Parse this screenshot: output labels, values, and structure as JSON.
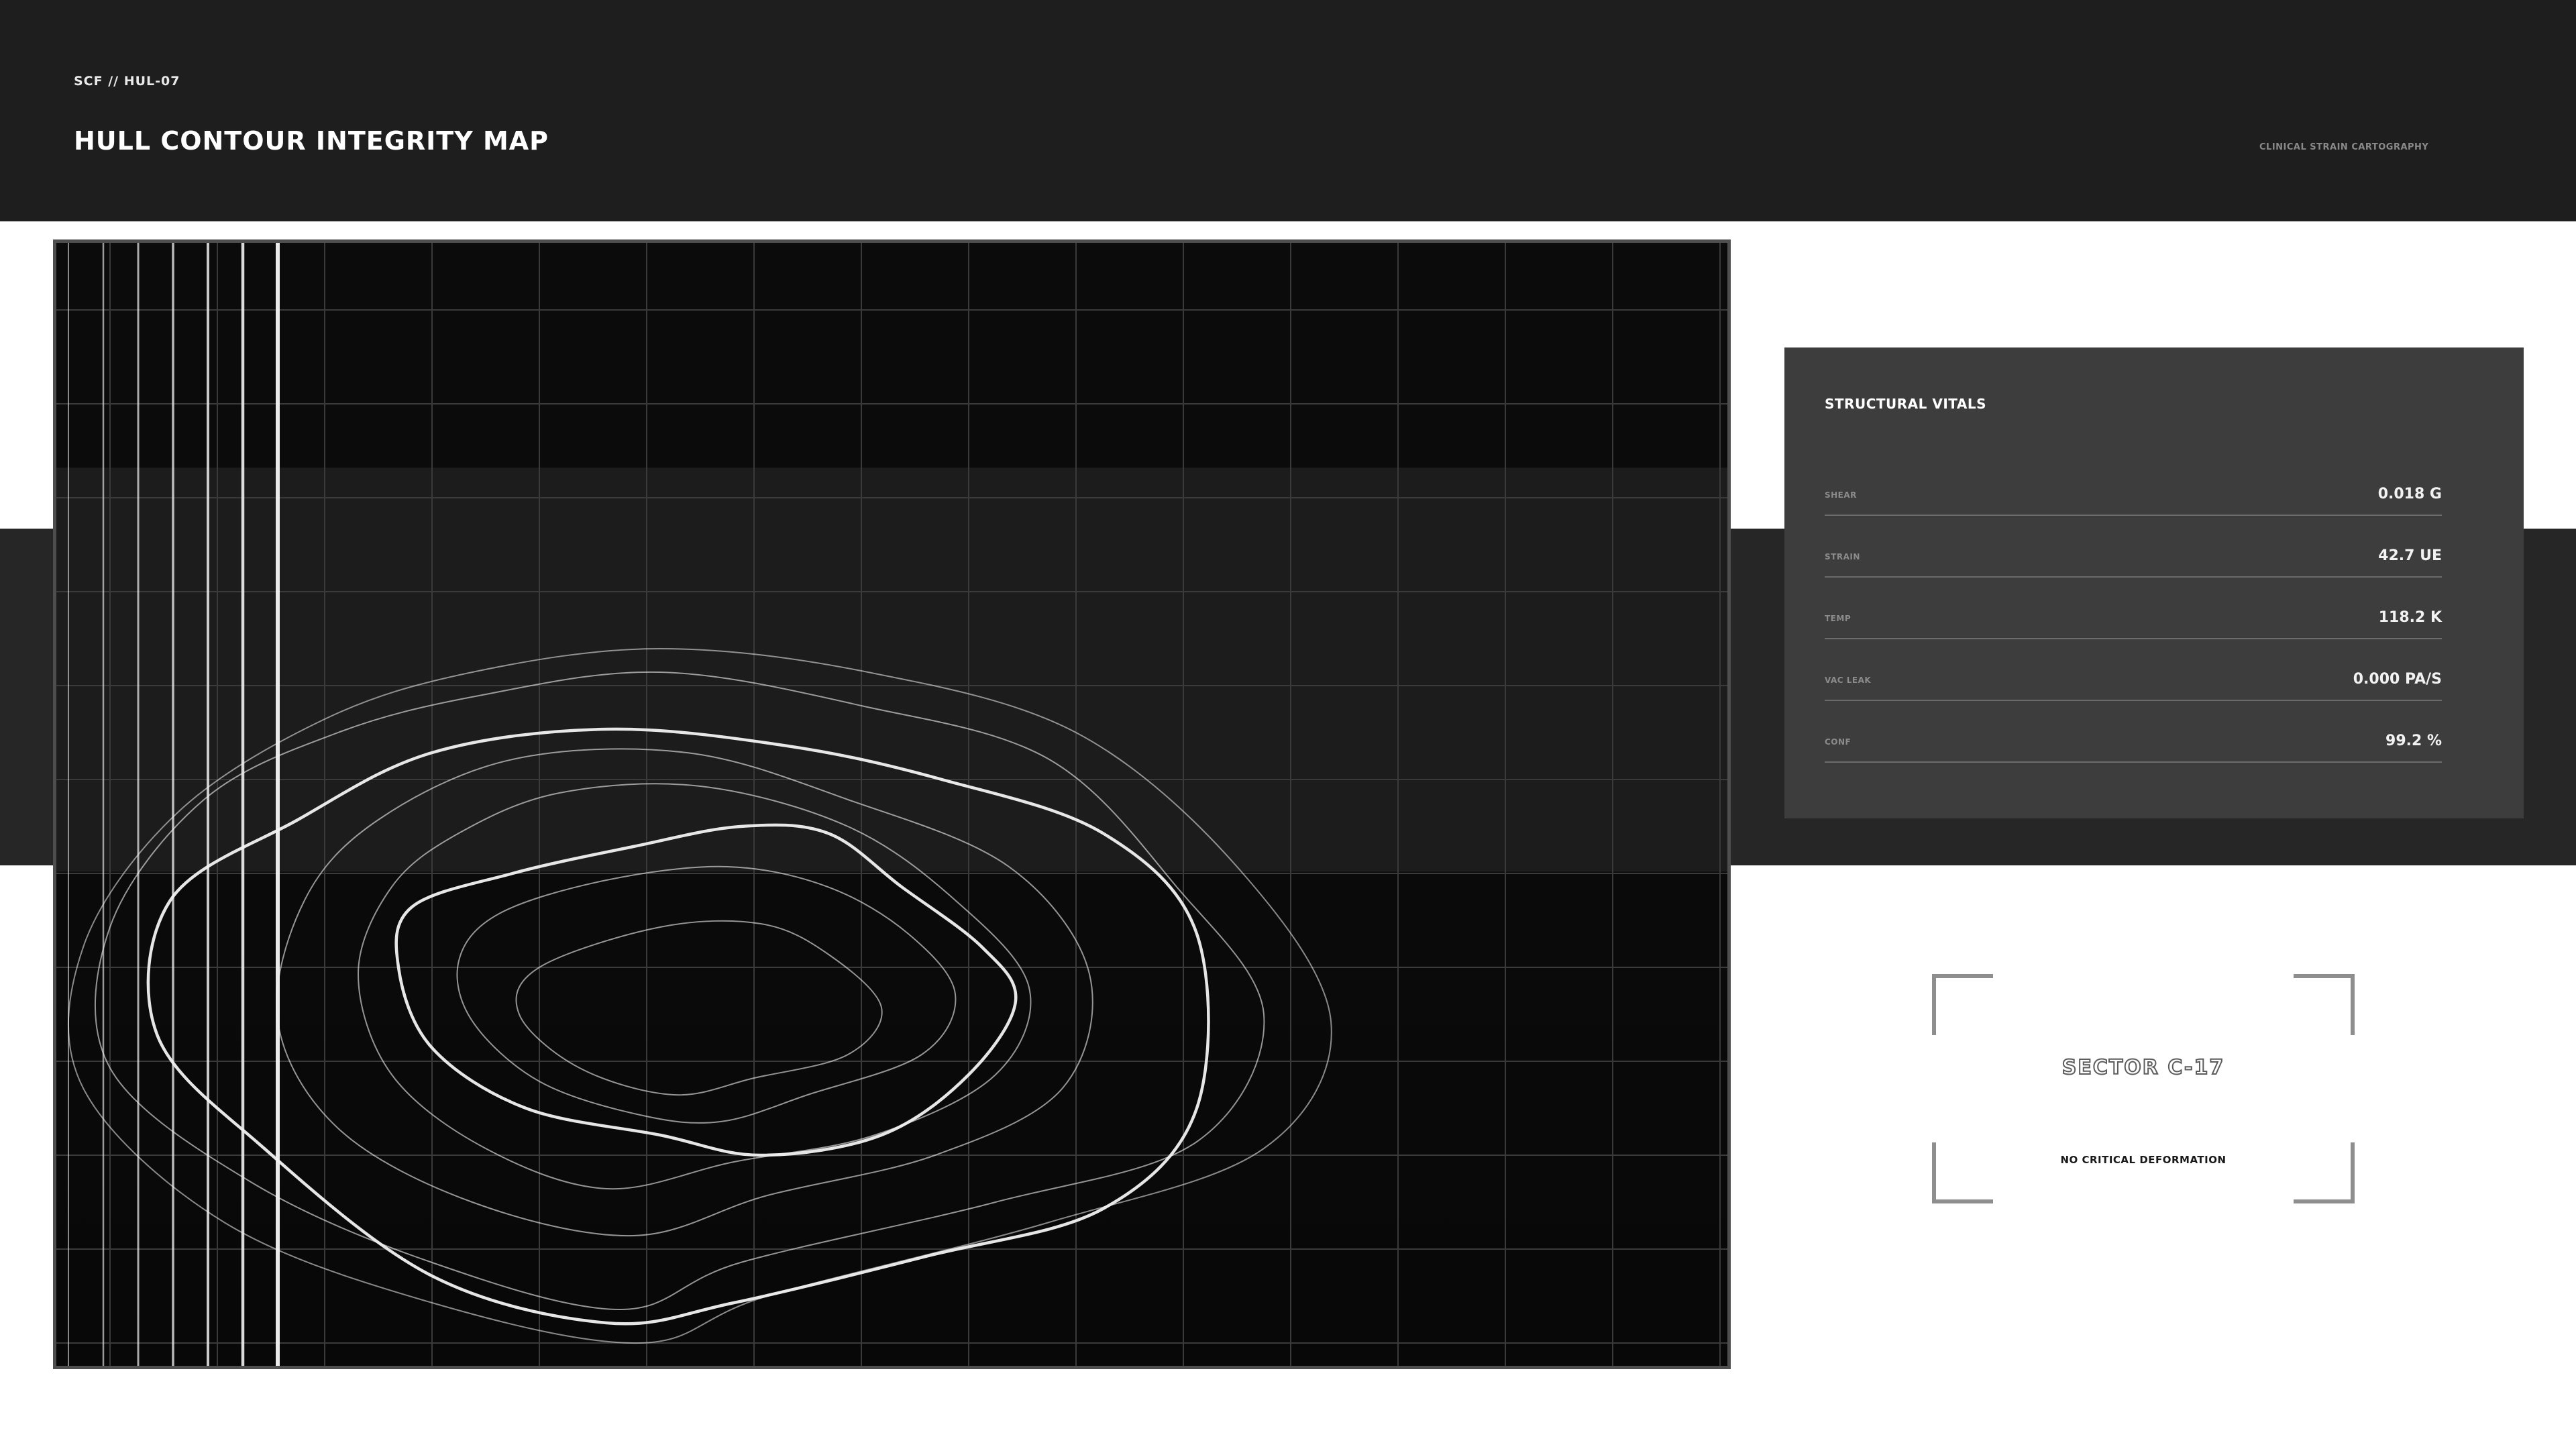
{
  "header": {
    "code": "SCF // HUL-07",
    "title": "HULL CONTOUR INTEGRITY MAP",
    "subtitle": "CLINICAL STRAIN CARTOGRAPHY"
  },
  "map": {
    "label": "",
    "line_color": "#f2f2f2",
    "grid_color": "#3a3a3a"
  },
  "vitals": {
    "heading": "STRUCTURAL VITALS",
    "rows": [
      {
        "label": "SHEAR",
        "value": "0.018 G"
      },
      {
        "label": "STRAIN",
        "value": "42.7 UE"
      },
      {
        "label": "TEMP",
        "value": "118.2 K"
      },
      {
        "label": "VAC LEAK",
        "value": "0.000 PA/S"
      },
      {
        "label": "CONF",
        "value": "99.2 %"
      }
    ]
  },
  "sector": {
    "name": "SECTOR C-17",
    "status": "NO CRITICAL DEFORMATION"
  }
}
